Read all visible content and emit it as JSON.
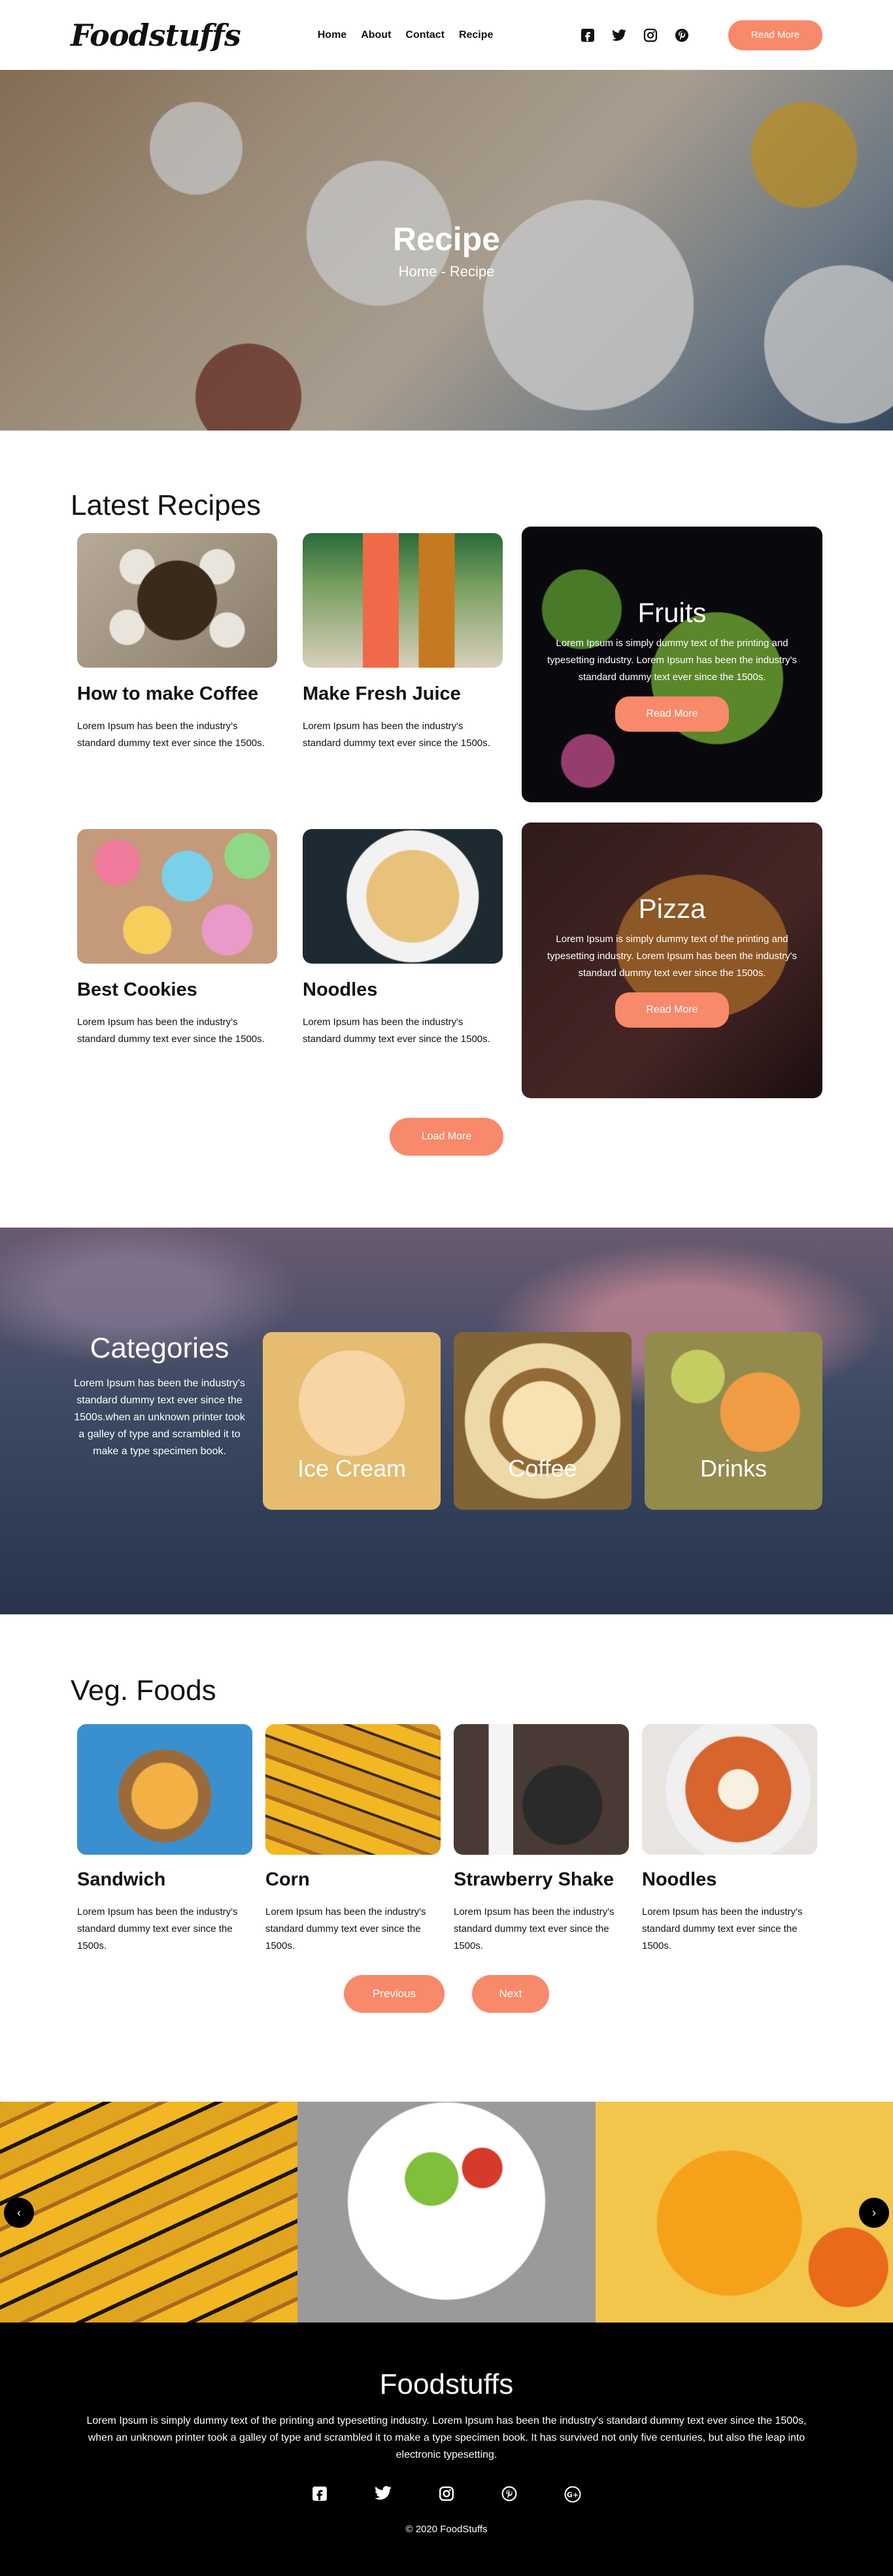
{
  "header": {
    "logo": "Foodstuffs",
    "nav": [
      "Home",
      "About",
      "Contact",
      "Recipe"
    ],
    "socials": [
      "facebook-icon",
      "twitter-icon",
      "instagram-icon",
      "pinterest-icon"
    ],
    "cta": "Read More"
  },
  "hero": {
    "title": "Recipe",
    "breadcrumb": "Home - Recipe"
  },
  "latest": {
    "title": "Latest Recipes",
    "cards": [
      {
        "title": "How to make Coffee",
        "text": "Lorem Ipsum has been the industry's standard dummy text ever since the 1500s."
      },
      {
        "title": "Make Fresh Juice",
        "text": "Lorem Ipsum has been the industry's standard dummy text ever since the 1500s."
      },
      {
        "title": "Best Cookies",
        "text": "Lorem Ipsum has been the industry's standard dummy text ever since the 1500s."
      },
      {
        "title": "Noodles",
        "text": "Lorem Ipsum has been the industry's standard dummy text ever since the 1500s."
      }
    ],
    "features": [
      {
        "title": "Fruits",
        "text": "Lorem Ipsum is simply dummy text of the printing and typesetting industry. Lorem Ipsum has been the industry's standard dummy text ever since the 1500s.",
        "button": "Read More"
      },
      {
        "title": "Pizza",
        "text": "Lorem Ipsum is simply dummy text of the printing and typesetting industry. Lorem Ipsum has been the industry's standard dummy text ever since the 1500s.",
        "button": "Read More"
      }
    ],
    "load_more": "Load More"
  },
  "categories": {
    "title": "Categories",
    "text": "Lorem Ipsum has been the industry's standard dummy text ever since the 1500s.when an unknown printer took a galley of type and scrambled it to make a type specimen book.",
    "items": [
      "Ice Cream",
      "Coffee",
      "Drinks"
    ]
  },
  "veg": {
    "title": "Veg. Foods",
    "cards": [
      {
        "title": "Sandwich",
        "text": "Lorem Ipsum has been the industry's standard dummy text ever since the 1500s."
      },
      {
        "title": "Corn",
        "text": "Lorem Ipsum has been the industry's standard dummy text ever since the 1500s."
      },
      {
        "title": "Strawberry Shake",
        "text": "Lorem Ipsum has been the industry's standard dummy text ever since the 1500s."
      },
      {
        "title": "Noodles",
        "text": "Lorem Ipsum has been the industry's standard dummy text ever since the 1500s."
      }
    ],
    "previous": "Previous",
    "next": "Next"
  },
  "gallery": {
    "prev_arrow": "‹",
    "next_arrow": "›"
  },
  "footer": {
    "title": "Foodstuffs",
    "text": "Lorem Ipsum is simply dummy text of the printing and typesetting industry. Lorem Ipsum has been the industry's standard dummy text ever since the 1500s, when an unknown printer took a galley of type and scrambled it to make a type specimen book. It has survived not only five centuries, but also the leap into electronic typesetting.",
    "socials": [
      "facebook-icon",
      "twitter-icon",
      "instagram-icon",
      "pinterest-icon",
      "google-plus-icon"
    ],
    "copyright": "© 2020 FoodStuffs"
  },
  "colors": {
    "accent": "#f8896b",
    "footer_bg": "#000000"
  }
}
